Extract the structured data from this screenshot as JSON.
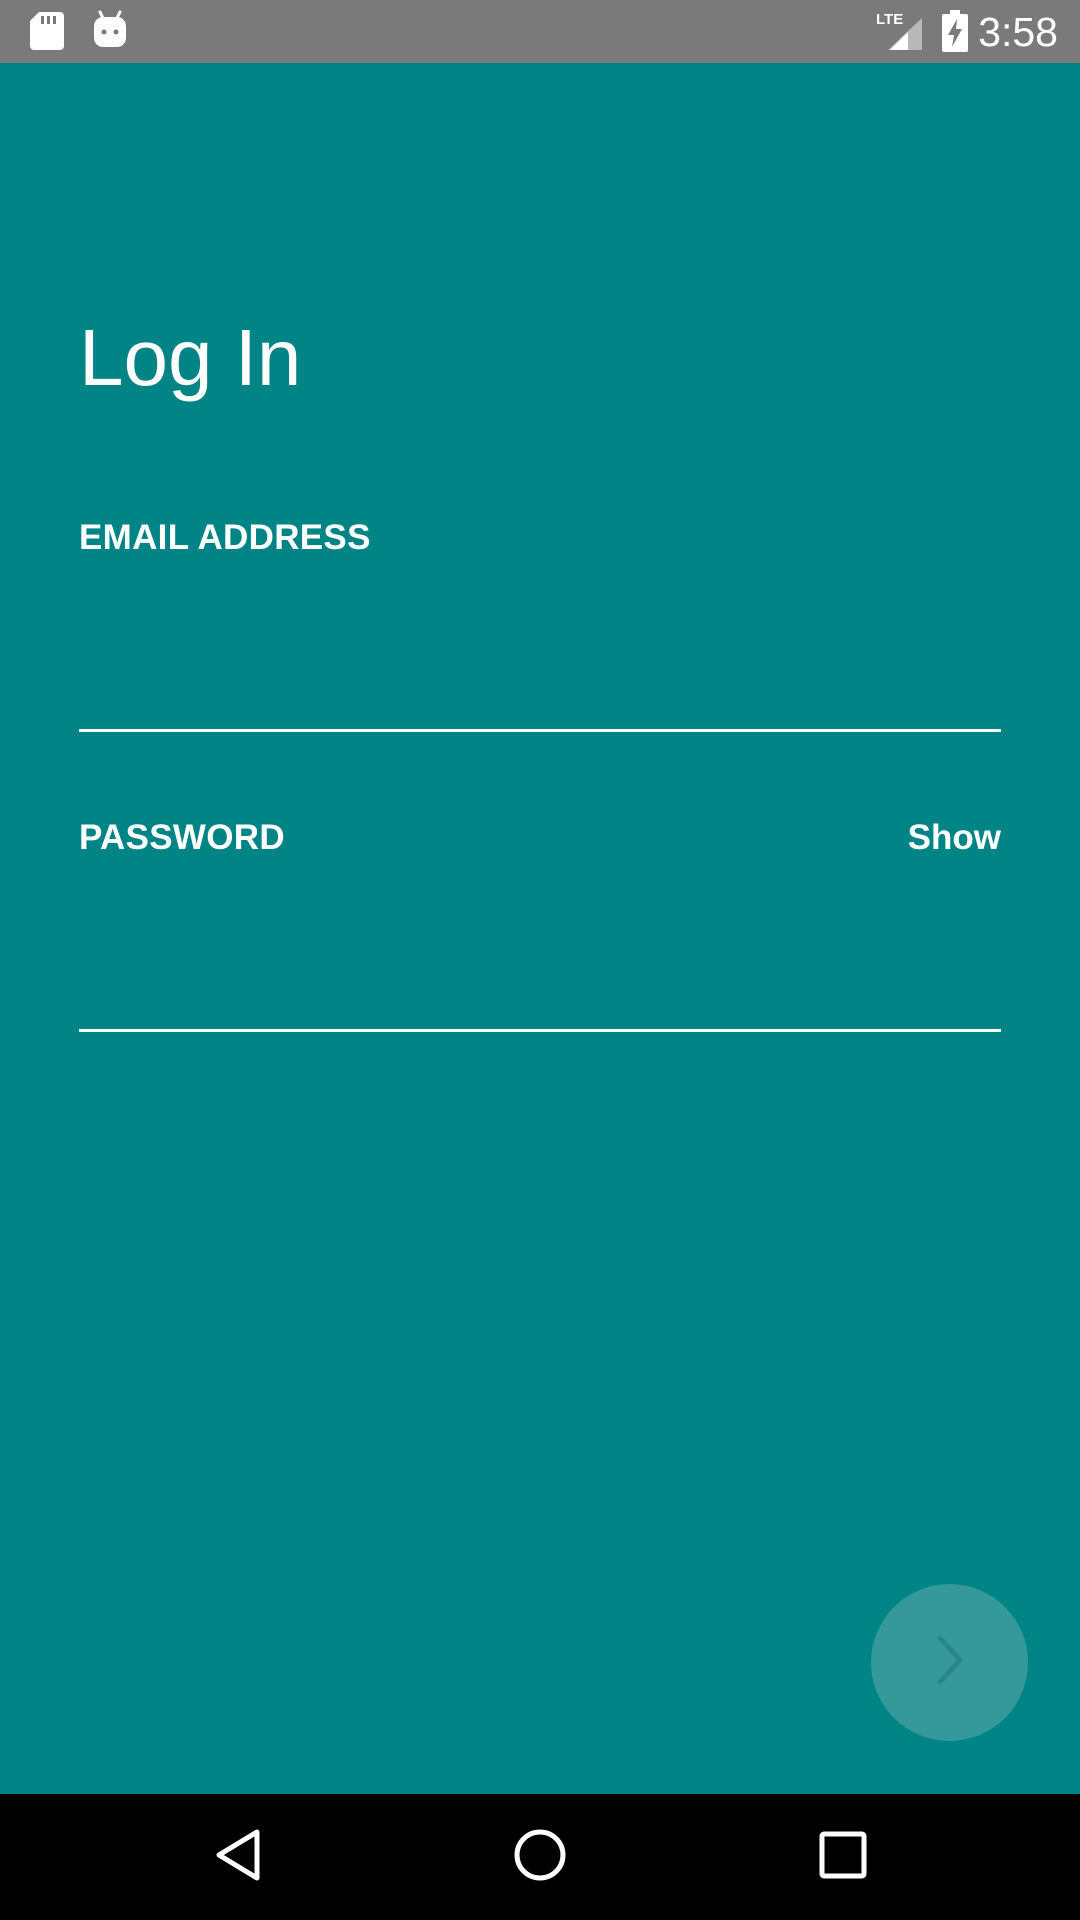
{
  "status_bar": {
    "time": "3:58",
    "network": "LTE",
    "icons": [
      "sd-card-icon",
      "android-icon",
      "lte-signal-icon",
      "battery-charging-icon"
    ]
  },
  "login": {
    "title": "Log In",
    "email_label": "EMAIL ADDRESS",
    "email_value": "",
    "password_label": "PASSWORD",
    "password_value": "",
    "show_label": "Show"
  },
  "fab": {
    "icon": "chevron-right-icon"
  },
  "nav_bar": {
    "buttons": [
      "back-icon",
      "home-icon",
      "recents-icon"
    ]
  },
  "colors": {
    "background": "#008486",
    "status_bar": "#7a7a7a",
    "fab": "#35999b",
    "text": "#ffffff",
    "nav_bar": "#000000"
  }
}
